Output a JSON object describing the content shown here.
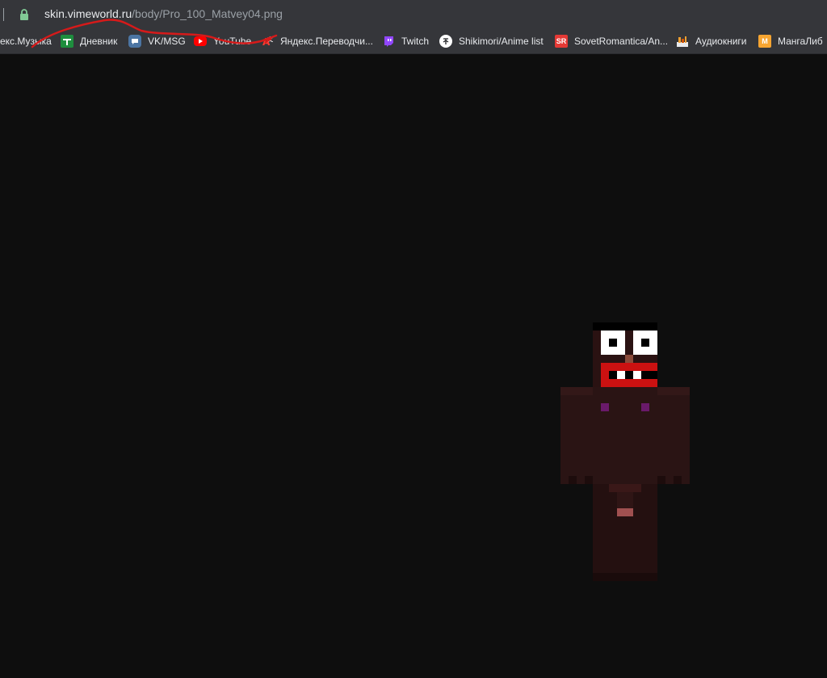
{
  "address_bar": {
    "url_host": "skin.vimeworld.ru",
    "url_path": "/body/Pro_100_Matvey04.png"
  },
  "bookmarks": [
    {
      "label": "екс.Музыка",
      "icon": "yandex-music-icon"
    },
    {
      "label": "Дневник",
      "icon": "diary-icon",
      "color": "#1e8e3e"
    },
    {
      "label": "VK/MSG",
      "icon": "vk-icon",
      "color": "#4c75a3"
    },
    {
      "label": "YouTube",
      "icon": "youtube-icon",
      "color": "#ff0000"
    },
    {
      "label": "Яндекс.Переводчи...",
      "icon": "yandex-translate-icon",
      "color": "#ff3b30"
    },
    {
      "label": "Twitch",
      "icon": "twitch-icon",
      "color": "#9146ff"
    },
    {
      "label": "Shikimori/Anime list",
      "icon": "shikimori-icon",
      "color": "#ffffff"
    },
    {
      "label": "SovetRomantica/An...",
      "icon": "sovetromantica-icon",
      "color": "#e53935"
    },
    {
      "label": "Аудиокниги",
      "icon": "audiobooks-icon",
      "color": "#f0a030"
    },
    {
      "label": "МангаЛиб",
      "icon": "mangalib-icon",
      "color": "#f7a531"
    }
  ],
  "image": {
    "content": "minecraft-skin-body-render"
  }
}
